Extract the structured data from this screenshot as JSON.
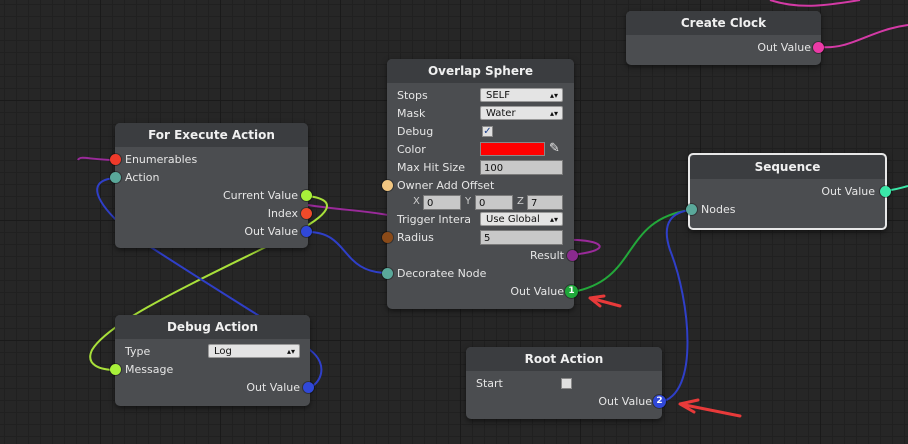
{
  "nodes": {
    "create_clock": {
      "title": "Create Clock",
      "out_value": "Out Value"
    },
    "overlap_sphere": {
      "title": "Overlap Sphere",
      "stops_label": "Stops",
      "stops_value": "SELF",
      "mask_label": "Mask",
      "mask_value": "Water",
      "debug_label": "Debug",
      "debug_checked": "✓",
      "color_label": "Color",
      "color_value": "#ff0000",
      "max_hit_label": "Max Hit Size",
      "max_hit_value": "100",
      "owner_offset_label": "Owner Add Offset",
      "x_label": "X",
      "x_value": "0",
      "y_label": "Y",
      "y_value": "0",
      "z_label": "Z",
      "z_value": "7",
      "trigger_label": "Trigger Intera",
      "trigger_value": "Use Global",
      "radius_label": "Radius",
      "radius_value": "5",
      "result_label": "Result",
      "decoratee_label": "Decoratee Node",
      "out_value": "Out Value",
      "out_index": "1"
    },
    "for_execute": {
      "title": "For Execute Action",
      "enumerables": "Enumerables",
      "action": "Action",
      "current_value": "Current Value",
      "index": "Index",
      "out_value": "Out Value"
    },
    "sequence": {
      "title": "Sequence",
      "out_value": "Out Value",
      "nodes": "Nodes"
    },
    "debug_action": {
      "title": "Debug Action",
      "type_label": "Type",
      "type_value": "Log",
      "message": "Message",
      "out_value": "Out Value"
    },
    "root_action": {
      "title": "Root Action",
      "start_label": "Start",
      "out_value": "Out Value",
      "out_index": "2"
    }
  },
  "colors": {
    "enum_port": "#ee3a2a",
    "action_port": "#5aa89a",
    "current_value_port": "#a8f03a",
    "index_port": "#ee4a2a",
    "out_value_port": "#3048d8",
    "message_port": "#a8f03a",
    "decoratee_port": "#5aa89a",
    "owner_offset_port": "#f2c681",
    "radius_port": "#8a4a18",
    "result_port": "#8a2a8e",
    "sphere_out_port": "#1fa83a",
    "clock_out_port": "#ea3aa6",
    "sequence_out_port": "#3ae8a8",
    "nodes_port": "#5aa89a",
    "root_out_port": "#3048d8",
    "wire_green": "#23a83a",
    "wire_blue": "#2f3fc8",
    "wire_lime": "#a8e03a",
    "wire_purple": "#9a2a9a",
    "wire_pink": "#d43aa6",
    "wire_teal": "#3ae8a8",
    "arrow_red": "#e83a3a",
    "annotation_green": "#8ae018"
  }
}
